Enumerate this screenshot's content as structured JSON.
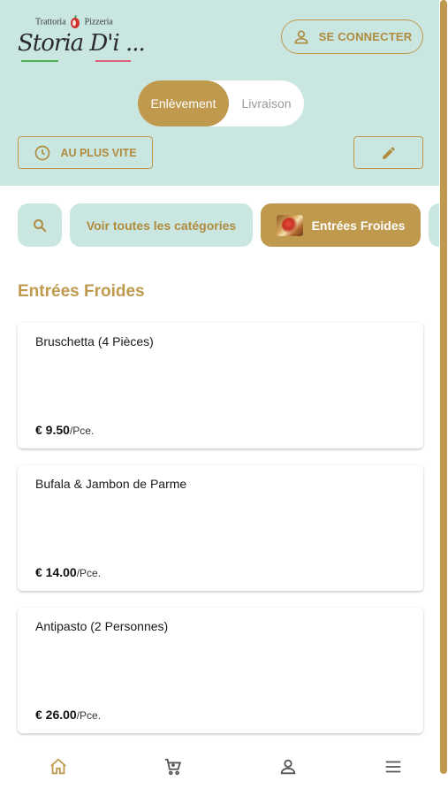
{
  "brand": {
    "top_left": "Trattoria",
    "top_right": "Pizzeria",
    "script_name": "Storia D'i ..."
  },
  "header": {
    "login_label": "SE CONNECTER",
    "mode_options": [
      "Enlèvement",
      "Livraison"
    ],
    "selected_mode": "Enlèvement",
    "time_label": "AU PLUS VITE"
  },
  "categories": {
    "all_label": "Voir toutes les catégories",
    "active_label": "Entrées Froides"
  },
  "section": {
    "title": "Entrées Froides"
  },
  "products": [
    {
      "name": "Bruschetta (4 Pièces)",
      "price": "€ 9.50",
      "unit": "/Pce."
    },
    {
      "name": "Bufala & Jambon de Parme",
      "price": "€ 14.00",
      "unit": "/Pce."
    },
    {
      "name": "Antipasto (2 Personnes)",
      "price": "€ 26.00",
      "unit": "/Pce."
    }
  ],
  "bottom_nav": [
    {
      "icon": "home-icon",
      "active": true
    },
    {
      "icon": "cart-icon",
      "active": false
    },
    {
      "icon": "user-icon",
      "active": false
    },
    {
      "icon": "menu-icon",
      "active": false
    }
  ],
  "colors": {
    "accent": "#bf9a4e",
    "header_bg": "#c9e7e0",
    "inactive_icon": "#555555"
  }
}
